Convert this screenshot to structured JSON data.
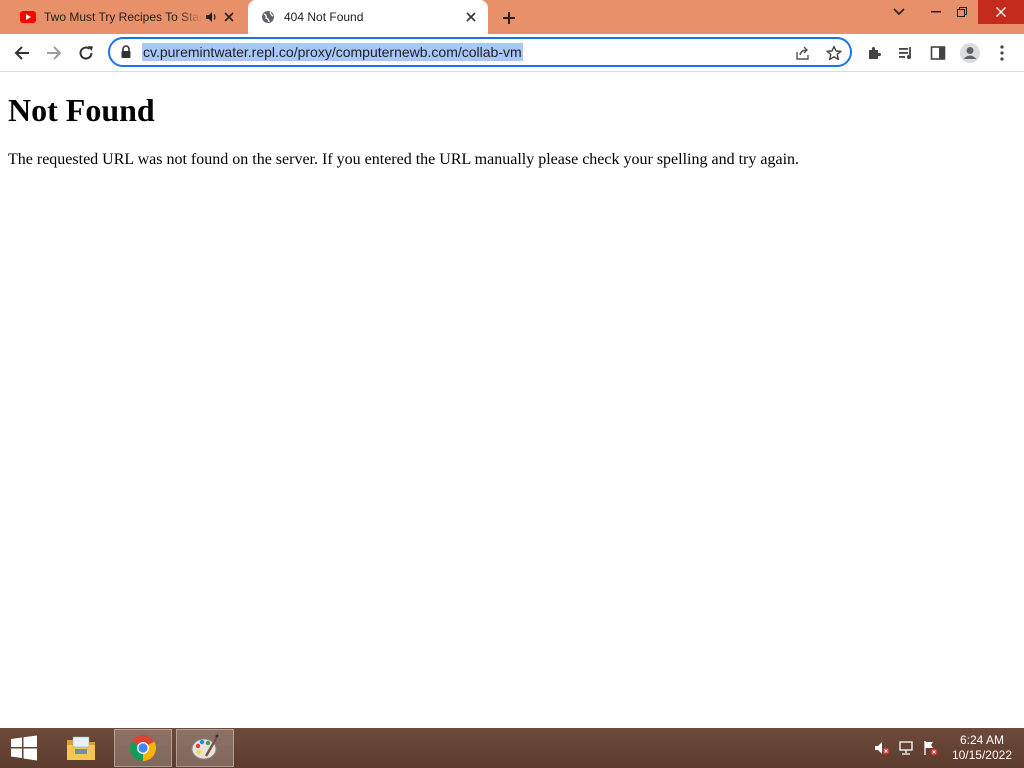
{
  "browser": {
    "tabs": [
      {
        "title": "Two Must Try Recipes To Start",
        "favicon": "youtube-icon",
        "audio": "speaker-icon"
      },
      {
        "title": "404 Not Found",
        "favicon": "globe-icon"
      }
    ],
    "address_bar": {
      "url": "cv.puremintwater.repl.co/proxy/computernewb.com/collab-vm"
    },
    "colors": {
      "tabstrip": "#e8906a",
      "accent": "#1a73e8",
      "selection": "#a8c7fa"
    }
  },
  "page": {
    "heading": "Not Found",
    "message": "The requested URL was not found on the server. If you entered the URL manually please check your spelling and try again."
  },
  "taskbar": {
    "apps": [
      "file-explorer-icon",
      "chrome-icon",
      "paint-icon"
    ],
    "clock": {
      "time": "6:24 AM",
      "date": "10/15/2022"
    }
  }
}
